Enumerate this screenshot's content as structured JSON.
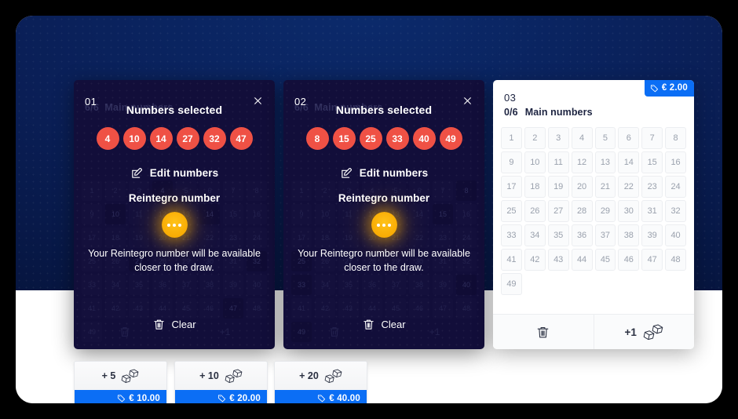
{
  "tickets": [
    {
      "index": "01",
      "overlay_title": "Numbers selected",
      "selected_numbers": [
        "4",
        "10",
        "14",
        "27",
        "32",
        "47"
      ],
      "edit_label": "Edit numbers",
      "reintegro_title": "Reintegro number",
      "reintegro_note": "Your Reintegro number will be available closer to the draw.",
      "clear_label": "Clear",
      "ghost_progress": "6/6",
      "ghost_label": "Main numbers"
    },
    {
      "index": "02",
      "overlay_title": "Numbers selected",
      "selected_numbers": [
        "8",
        "15",
        "25",
        "33",
        "40",
        "49"
      ],
      "edit_label": "Edit numbers",
      "reintegro_title": "Reintegro number",
      "reintegro_note": "Your Reintegro number will be available closer to the draw.",
      "clear_label": "Clear",
      "ghost_progress": "6/6",
      "ghost_label": "Main numbers"
    }
  ],
  "picker": {
    "index": "03",
    "price_badge": "€ 2.00",
    "progress": "0/6",
    "progress_label": "Main numbers",
    "numbers": [
      "1",
      "2",
      "3",
      "4",
      "5",
      "6",
      "7",
      "8",
      "9",
      "10",
      "11",
      "12",
      "13",
      "14",
      "15",
      "16",
      "17",
      "18",
      "19",
      "20",
      "21",
      "22",
      "23",
      "24",
      "25",
      "26",
      "27",
      "28",
      "29",
      "30",
      "31",
      "32",
      "33",
      "34",
      "35",
      "36",
      "37",
      "38",
      "39",
      "40",
      "41",
      "42",
      "43",
      "44",
      "45",
      "46",
      "47",
      "48",
      "49"
    ],
    "footer": {
      "clear_icon": "trash-icon",
      "quickpick_label": "+1",
      "quickpick_icon": "dice-icon"
    }
  },
  "quick_picks": [
    {
      "count_label": "+ 5",
      "price": "€ 10.00"
    },
    {
      "count_label": "+ 10",
      "price": "€ 20.00"
    },
    {
      "count_label": "+ 20",
      "price": "€ 40.00"
    }
  ],
  "colors": {
    "ball_red": "#ef5145",
    "accent_blue": "#0b6ef5",
    "reintegro_gold": "#f9ae06",
    "overlay_navy": "#120e3a"
  },
  "icons": {
    "close": "close-icon",
    "edit": "edit-pencil-icon",
    "trash": "trash-icon",
    "dice": "dice-icon",
    "tag": "price-tag-icon"
  }
}
